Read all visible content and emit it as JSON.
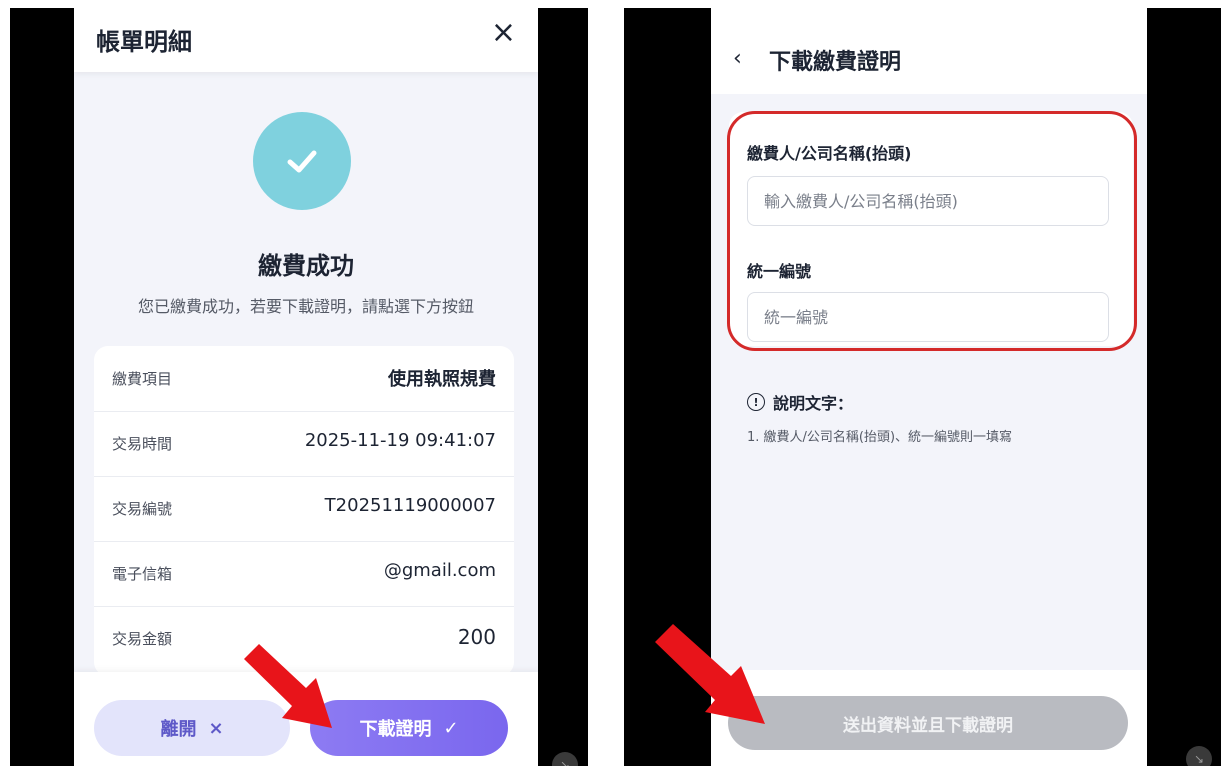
{
  "left": {
    "header": {
      "title": "帳單明細",
      "close_icon": "×"
    },
    "status": {
      "title": "繳費成功",
      "description": "您已繳費成功，若要下載證明，請點選下方按鈕"
    },
    "details": [
      {
        "label": "繳費項目",
        "value": "使用執照規費"
      },
      {
        "label": "交易時間",
        "value": "2025-11-19 09:41:07"
      },
      {
        "label": "交易編號",
        "value": "T20251119000007"
      },
      {
        "label": "電子信箱",
        "value": "@gmail.com"
      },
      {
        "label": "交易金額",
        "value": "200"
      }
    ],
    "buttons": {
      "leave_label": "離開",
      "leave_icon": "×",
      "download_label": "下載證明",
      "download_icon": "✓"
    }
  },
  "right": {
    "header": {
      "title": "下載繳費證明",
      "back_icon": "‹"
    },
    "form": {
      "payer_label": "繳費人/公司名稱(抬頭)",
      "payer_placeholder": "輸入繳費人/公司名稱(抬頭)",
      "tax_label": "統一編號",
      "tax_placeholder": "統一編號"
    },
    "note": {
      "title": "說明文字：",
      "text": "1. 繳費人/公司名稱(抬頭)、統一編號則一填寫"
    },
    "submit_label": "送出資料並且下載證明"
  },
  "colors": {
    "accent": "#7a67ee",
    "success": "#7fd1de",
    "highlight": "#d42a2a",
    "arrow": "#e8141a"
  }
}
